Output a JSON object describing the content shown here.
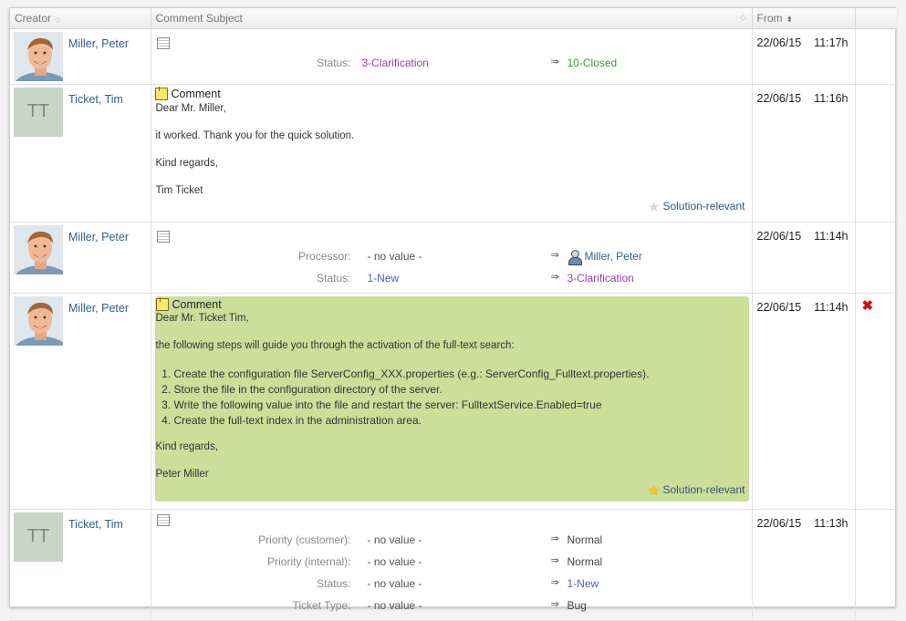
{
  "header": {
    "creator": "Creator",
    "subject": "Comment Subject",
    "from": "From"
  },
  "rows": [
    {
      "creator": "Miller, Peter",
      "date": "22/06/15",
      "time": "11:17h",
      "changes": [
        {
          "label": "Status:",
          "old": "3-Clarification",
          "new": "10-Closed"
        }
      ]
    },
    {
      "creator": "Ticket, Tim",
      "initials": "TT",
      "date": "22/06/15",
      "time": "11:16h",
      "comment_title": "Comment",
      "lines": [
        "Dear Mr. Miller,",
        "it worked. Thank you for the quick solution.",
        "Kind regards,",
        "Tim Ticket"
      ],
      "relevant": "Solution-relevant"
    },
    {
      "creator": "Miller, Peter",
      "date": "22/06/15",
      "time": "11:14h",
      "changes": [
        {
          "label": "Processor:",
          "old": "- no value -",
          "new": "Miller, Peter"
        },
        {
          "label": "Status:",
          "old": "1-New",
          "new": "3-Clarification"
        }
      ]
    },
    {
      "creator": "Miller, Peter",
      "date": "22/06/15",
      "time": "11:14h",
      "comment_title": "Comment",
      "greeting": "Dear Mr. Ticket Tim,",
      "intro": "the following steps will guide you through the activation of the full-text search:",
      "steps": [
        "Create the configuration file ServerConfig_XXX.properties (e.g.: ServerConfig_Fulltext.properties).",
        "Store the file in the configuration directory of the server.",
        "Write the following value into the file and restart the server: FulltextService.Enabled=true",
        "Create the full-text index in the administration area."
      ],
      "closing": "Kind regards,",
      "signature": "Peter Miller",
      "relevant": "Solution-relevant",
      "delete_glyph": "✖"
    },
    {
      "creator": "Ticket, Tim",
      "initials": "TT",
      "date": "22/06/15",
      "time": "11:13h",
      "changes": [
        {
          "label": "Priority (customer):",
          "old": "- no value -",
          "new": "Normal"
        },
        {
          "label": "Priority (internal):",
          "old": "- no value -",
          "new": "Normal"
        },
        {
          "label": "Status:",
          "old": "- no value -",
          "new": "1-New"
        },
        {
          "label": "Ticket Type:",
          "old": "- no value -",
          "new": "Bug"
        }
      ]
    }
  ],
  "icons": {
    "arrow": "⇒",
    "star_empty": "★",
    "star_full": "★",
    "sort": "⬦",
    "sort_desc": "⇟"
  },
  "colors": {
    "status_clarification": "#9a3fb0",
    "status_new": "#4a5fd0",
    "status_closed": "#3a9a3a",
    "highlight_comment": "#cddd9a",
    "delete": "#d01010"
  }
}
